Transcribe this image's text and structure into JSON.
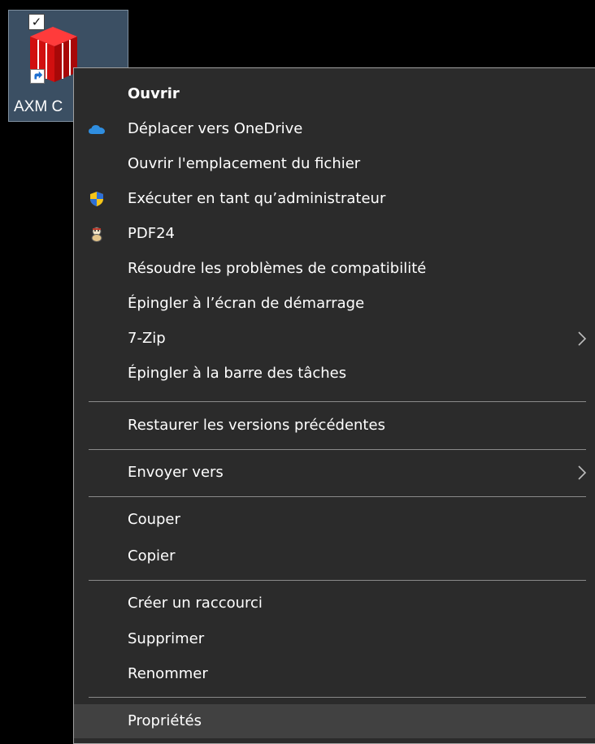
{
  "desktop": {
    "icon_label": "AXM C"
  },
  "menu": {
    "items": [
      {
        "label": "Ouvrir",
        "bold": true
      },
      {
        "label": "Déplacer vers OneDrive",
        "icon": "onedrive-icon"
      },
      {
        "label": "Ouvrir l'emplacement du fichier"
      },
      {
        "label": "Exécuter en tant qu’administrateur",
        "icon": "uac-shield-icon"
      },
      {
        "label": "PDF24",
        "icon": "pdf24-icon"
      },
      {
        "label": "Résoudre les problèmes de compatibilité"
      },
      {
        "label": "Épingler à l’écran de démarrage"
      },
      {
        "label": "7-Zip",
        "submenu": true
      },
      {
        "label": "Épingler à la barre des tâches"
      },
      {
        "label": "Restaurer les versions précédentes"
      },
      {
        "label": "Envoyer vers",
        "submenu": true
      },
      {
        "label": "Couper"
      },
      {
        "label": "Copier"
      },
      {
        "label": "Créer un raccourci"
      },
      {
        "label": "Supprimer"
      },
      {
        "label": "Renommer"
      },
      {
        "label": "Propriétés",
        "highlighted": true
      }
    ]
  },
  "colors": {
    "menu_background": "#2b2b2b",
    "highlight": "#414141",
    "onedrive_blue": "#2f8ee0"
  }
}
